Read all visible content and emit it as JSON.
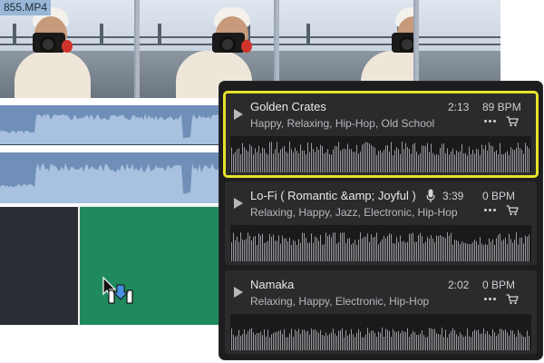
{
  "timeline": {
    "file_label": "855.MP4"
  },
  "library": {
    "tracks": [
      {
        "title": "Golden Crates",
        "tags": "Happy, Relaxing, Hip-Hop, Old School",
        "duration": "2:13",
        "bpm": "89 BPM",
        "selected": true,
        "has_mic": false,
        "wave_seed": 7,
        "wave_level": 0.95
      },
      {
        "title": "Lo-Fi ( Romantic &amp; Joyful )",
        "tags": "Relaxing, Happy, Jazz, Electronic, Hip-Hop",
        "duration": "3:39",
        "bpm": "0 BPM",
        "selected": false,
        "has_mic": true,
        "wave_seed": 3,
        "wave_level": 0.9
      },
      {
        "title": "Namaka",
        "tags": "Relaxing, Happy, Electronic, Hip-Hop",
        "duration": "2:02",
        "bpm": "0 BPM",
        "selected": false,
        "has_mic": false,
        "wave_seed": 11,
        "wave_level": 0.7
      }
    ]
  },
  "icons": {
    "play": "play-icon",
    "more": "more-icon",
    "cart": "cart-icon",
    "mic": "mic-icon",
    "cursor": "insert-cursor-icon"
  },
  "colors": {
    "highlight": "#e6e22a",
    "panel_bg": "#1d1d1f",
    "card_bg": "#2b2b2e",
    "clip_green": "#1f8a5e",
    "audio_blue": "#6f8fb8"
  }
}
